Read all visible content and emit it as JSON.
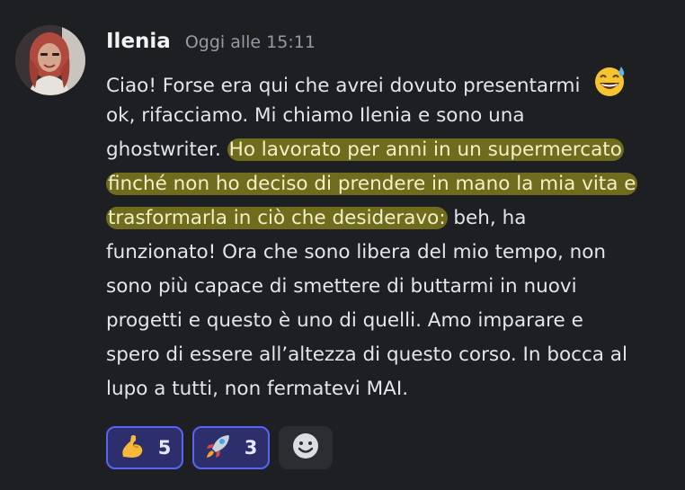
{
  "message": {
    "author": "Ilenia",
    "timestamp": "Oggi alle 15:11",
    "lines": [
      {
        "plain": "Ciao! Forse era qui che avrei dovuto presentarmi",
        "emoji": "sweat-smile-emoji"
      },
      {
        "plain": "ok, rifacciamo. Mi chiamo Ilenia e sono una"
      },
      {
        "plain": "ghostwriter. ",
        "highlight": "Ho lavorato per anni in un supermercato"
      },
      {
        "highlight": "finché non ho deciso di prendere in mano la mia vita e"
      },
      {
        "highlight": "trasformarla in ciò che desideravo:",
        "plain_after": " beh, ha"
      },
      {
        "plain": "funzionato! Ora che sono libera del mio tempo, non"
      },
      {
        "plain": "sono più capace di smettere di buttarmi in nuovi"
      },
      {
        "plain": "progetti e questo è uno di quelli. Amo imparare e"
      },
      {
        "plain": "spero di essere all’altezza di questo corso. In bocca al"
      },
      {
        "plain": "lupo a tutti, non fermatevi MAI."
      }
    ],
    "highlight_color": "#b4ac1c"
  },
  "reactions": [
    {
      "emoji": "flexed-biceps-emoji",
      "count": "5"
    },
    {
      "emoji": "rocket-emoji",
      "count": "3"
    }
  ],
  "add_reaction": {
    "icon": "add-reaction-icon"
  },
  "colors": {
    "background": "#1e1f22",
    "accent": "#5865f2",
    "reaction_active_bg": "#2c2f6b"
  }
}
